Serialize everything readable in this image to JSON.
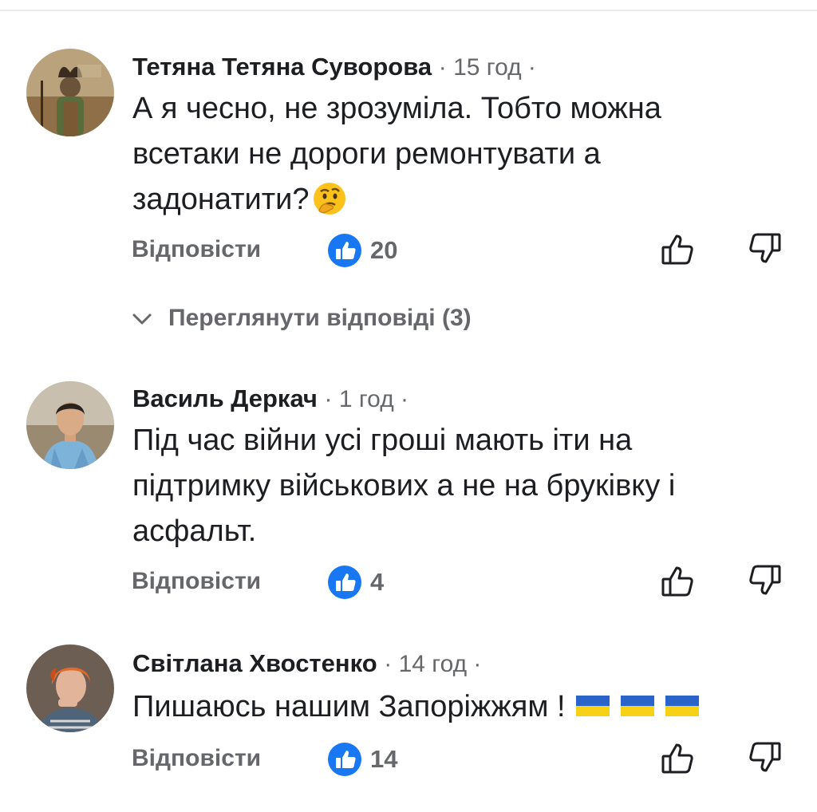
{
  "comments": [
    {
      "author": "Тетяна Тетяна Суворова",
      "time": "· 15 год ·",
      "text": "А я чесно, не зрозуміла. Тобто можна всетаки не дороги ремонтувати а задонатити?",
      "emoji": "thinking-face",
      "reply_label": "Відповісти",
      "likes": "20",
      "view_replies": "Переглянути відповіді (3)"
    },
    {
      "author": "Василь Деркач",
      "time": "· 1 год ·",
      "text": "Під час війни усі гроші мають іти на підтримку військових а не на бруківку і асфальт.",
      "reply_label": "Відповісти",
      "likes": "4"
    },
    {
      "author": "Світлана Хвостенко",
      "time": "· 14 год ·",
      "text": "Пишаюсь нашим Запоріжжям !",
      "emoji": "ukraine-flag ×3",
      "reply_label": "Відповісти",
      "likes": "14"
    }
  ],
  "colors": {
    "like_blue": "#1877f2",
    "muted_text": "#65676b",
    "flag_blue": "#2a64c8",
    "flag_yellow": "#f7d116"
  }
}
